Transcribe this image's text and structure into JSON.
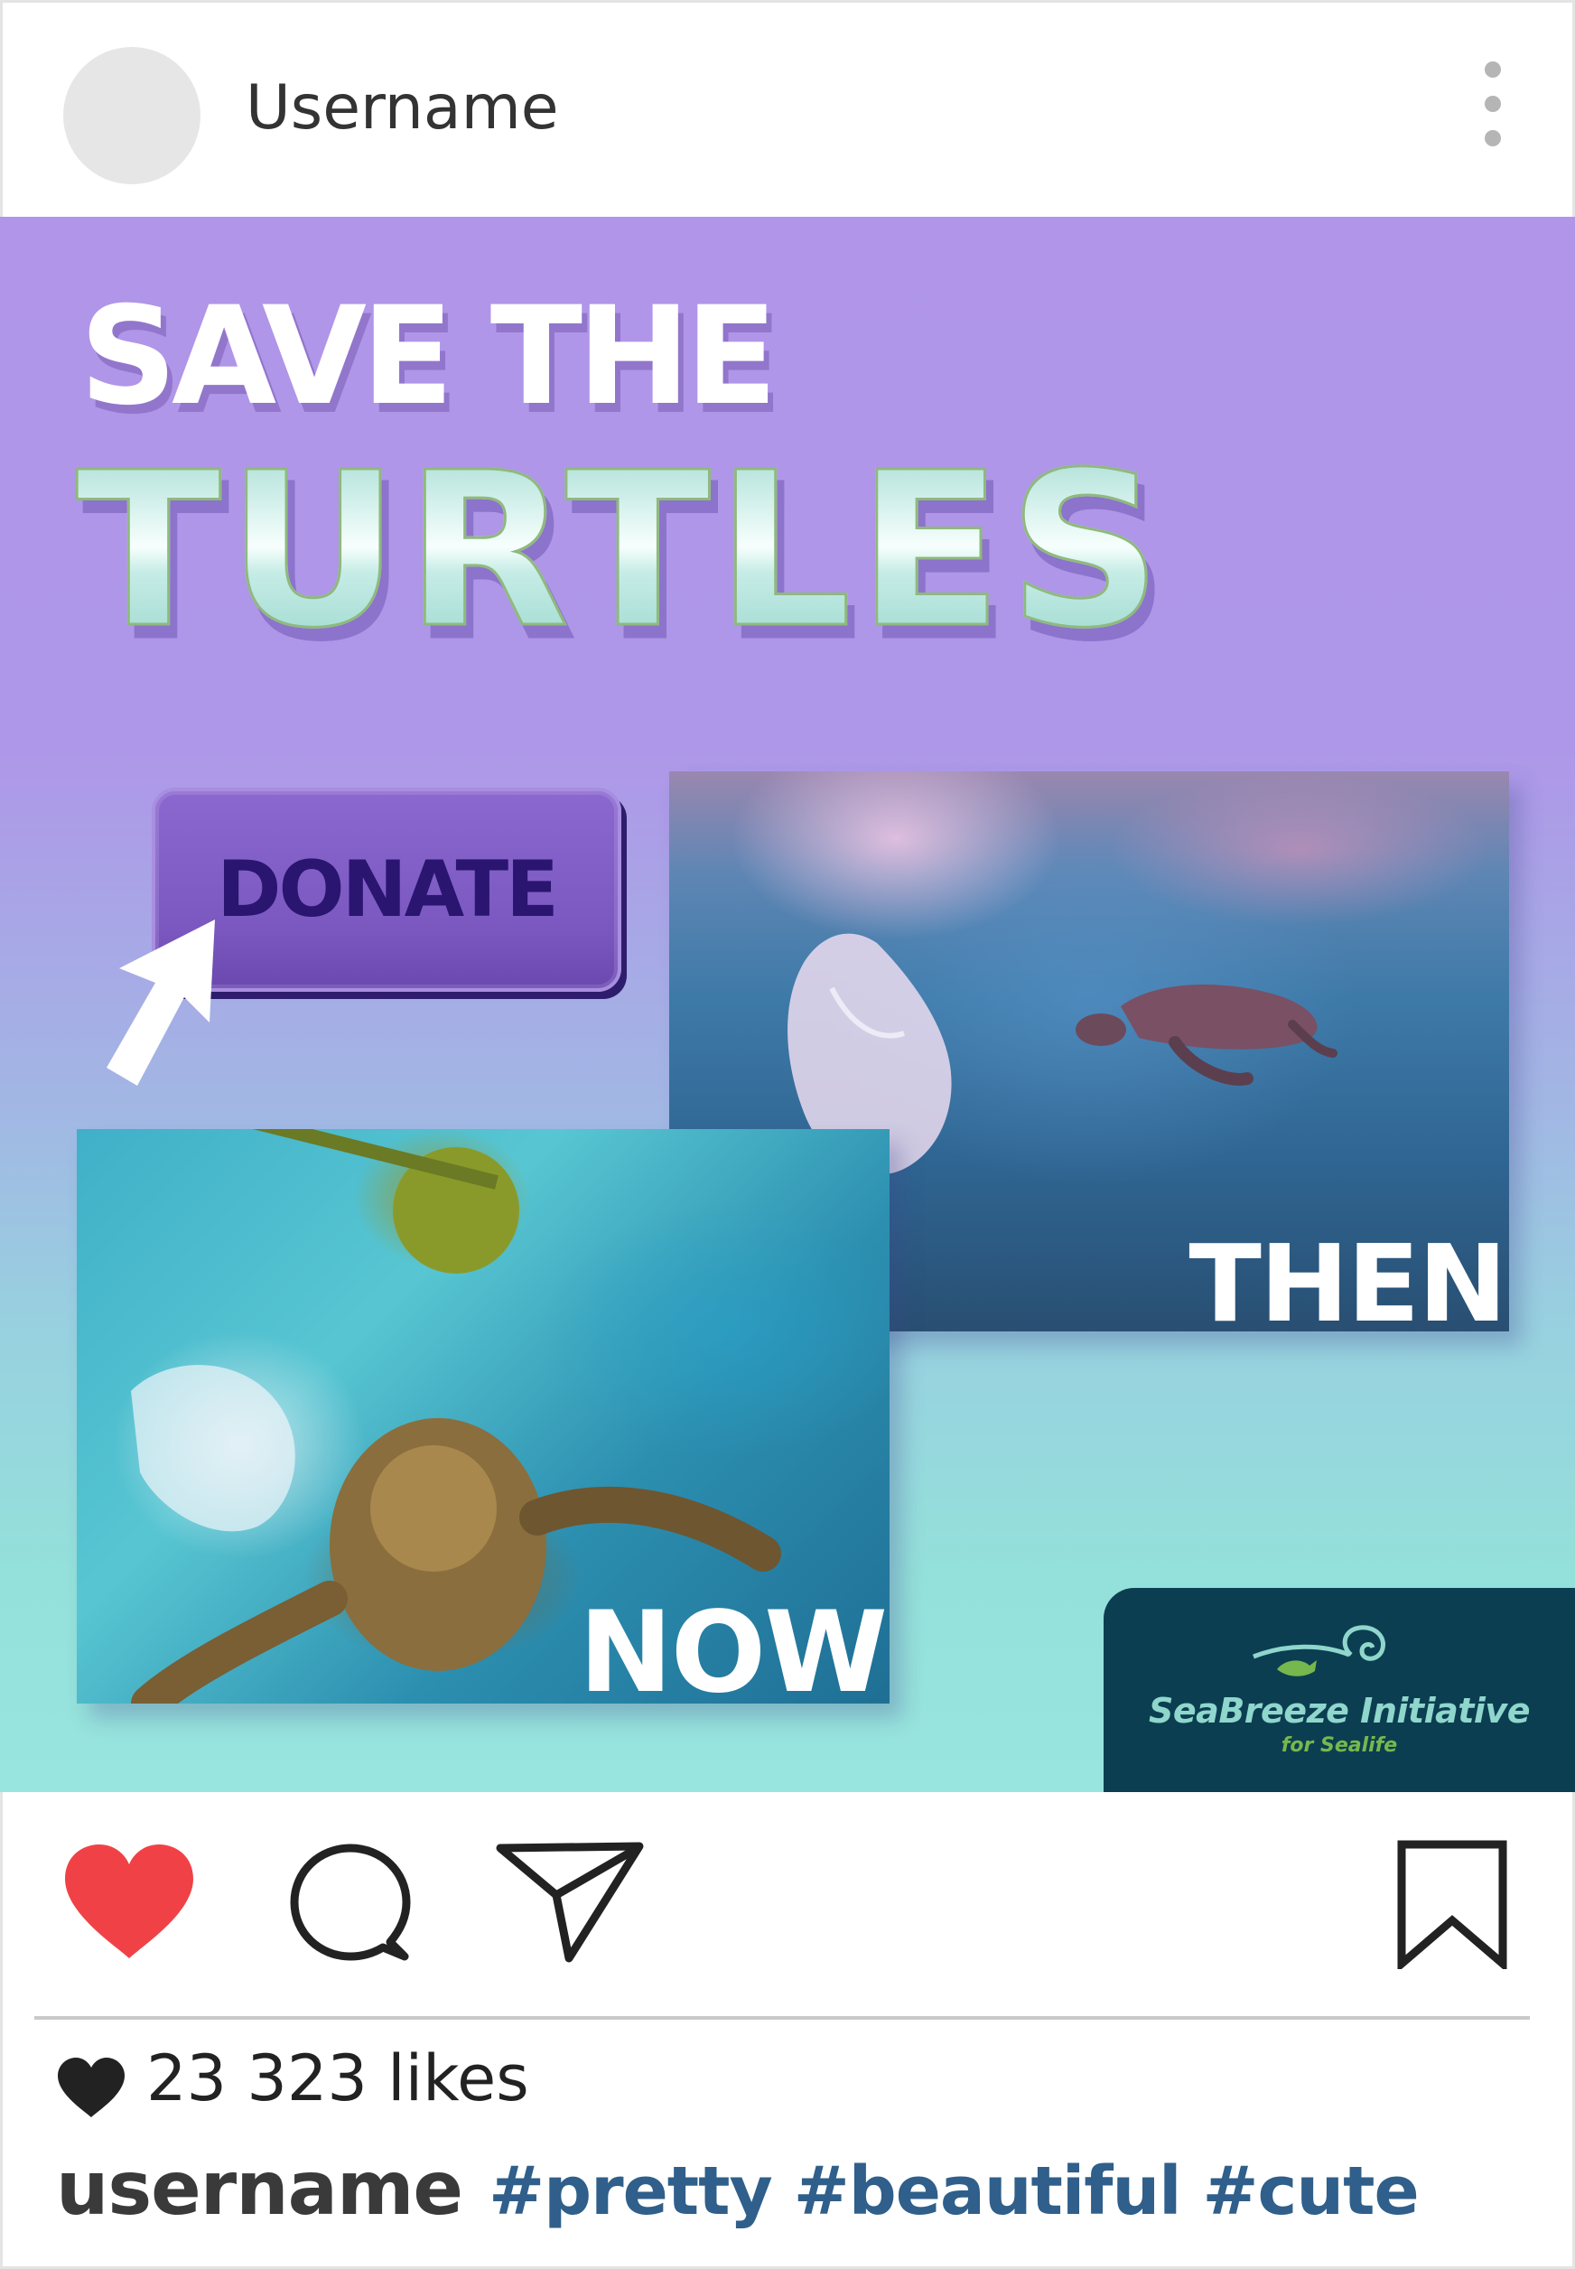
{
  "header": {
    "username": "Username",
    "avatar_color": "#e6e6e6",
    "more_icon": "more-vertical-icon"
  },
  "post": {
    "title_line1": "SAVE THE",
    "title_line2": "TURTLES",
    "donate_label": "DONATE",
    "photo_then_caption": "THEN",
    "photo_now_caption": "NOW",
    "brand": {
      "name": "SeaBreeze Initiative",
      "tagline": "for Sealife",
      "badge_color": "#0c3e52"
    },
    "colors": {
      "background_top": "#b095e8",
      "background_bottom": "#98e4de",
      "donate_button": "#7a58c0",
      "title_accent": "#a6ddd4"
    }
  },
  "actions": {
    "like_icon": "heart-icon",
    "like_color": "#f04246",
    "comment_icon": "comment-icon",
    "share_icon": "send-icon",
    "save_icon": "bookmark-icon"
  },
  "likes": {
    "count_text": "23 323 likes"
  },
  "caption": {
    "username": "username",
    "hashtags": [
      "#pretty",
      "#beautiful",
      "#cute"
    ],
    "hashtag_color": "#2f5f8a"
  }
}
